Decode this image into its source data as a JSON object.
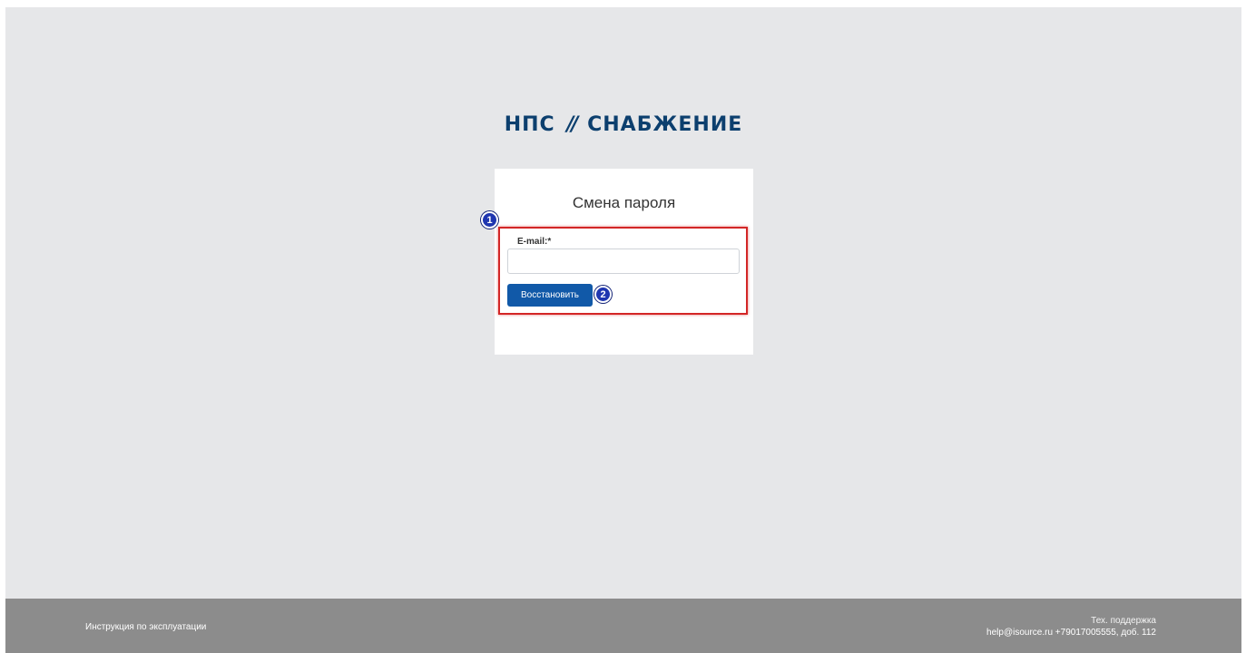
{
  "logo": {
    "left": "НПС",
    "slash": "//",
    "right": "СНАБЖЕНИЕ",
    "color": "#0c3f6e"
  },
  "form": {
    "title": "Смена пароля",
    "email_label": "E-mail:*",
    "email_value": "",
    "submit_label": "Восстановить"
  },
  "annotations": {
    "badge_1": "1",
    "badge_2": "2",
    "highlight_color": "#d32626",
    "badge_color": "#1f36b0"
  },
  "footer": {
    "manual_link": "Инструкция по эксплуатации",
    "support_title": "Тех. поддержка",
    "support_contact": "help@isource.ru +79017005555, доб. 112"
  },
  "colors": {
    "background": "#e6e7e9",
    "accent": "#1159a8",
    "footer": "#8c8c8c"
  }
}
